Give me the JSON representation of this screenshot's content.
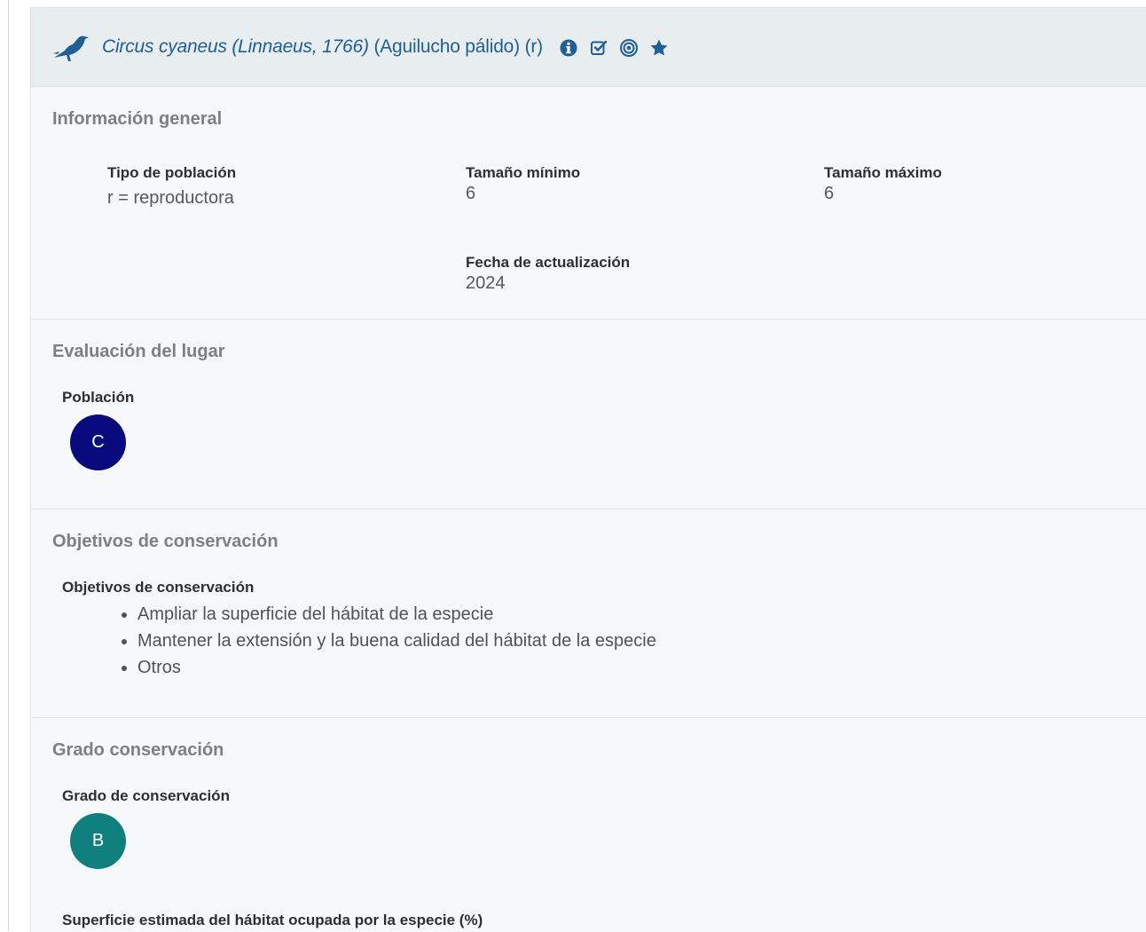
{
  "header": {
    "scientific_name": "Circus cyaneus (Linnaeus, 1766)",
    "common_name": " (Aguilucho pálido) (r)",
    "icons": [
      "bird-icon",
      "info-icon",
      "checkbox-icon",
      "target-icon",
      "star-icon"
    ],
    "accent_color": "#1f5f96"
  },
  "general": {
    "title": "Información general",
    "population_type_label": "Tipo de población",
    "population_type_value": "r = reproductora",
    "min_size_label": "Tamaño mínimo",
    "min_size_value": "6",
    "max_size_label": "Tamaño máximo",
    "max_size_value": "6",
    "update_date_label": "Fecha de actualización",
    "update_date_value": "2024"
  },
  "evaluation": {
    "title": "Evaluación del lugar",
    "population_label": "Población",
    "population_grade": "C",
    "population_grade_color": "#0a0a7f"
  },
  "objectives": {
    "title": "Objetivos de conservación",
    "label": "Objetivos de conservación",
    "items": [
      "Ampliar la superficie del hábitat de la especie",
      "Mantener la extensión y la buena calidad del hábitat de la especie",
      "Otros"
    ]
  },
  "conservation": {
    "title": "Grado conservación",
    "grade_label": "Grado de conservación",
    "grade": "B",
    "grade_color": "#0f807d",
    "surface_label": "Superficie estimada del hábitat ocupada por la especie (%)"
  }
}
